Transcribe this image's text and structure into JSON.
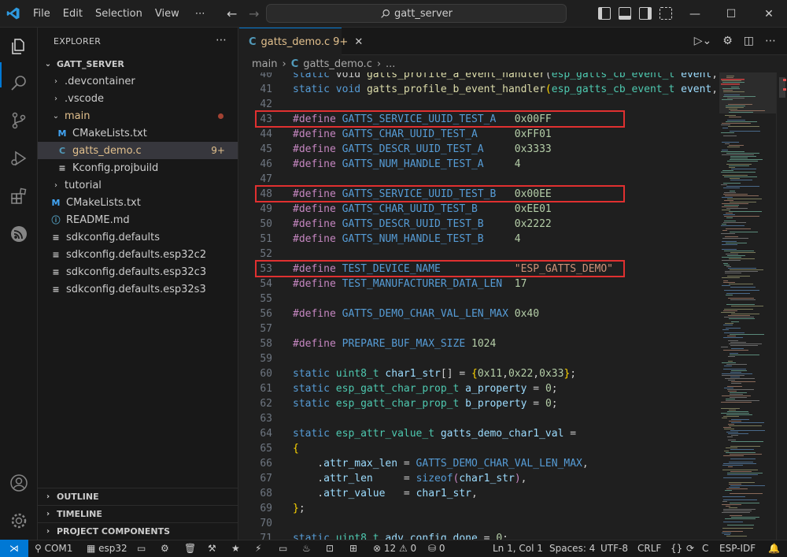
{
  "menu": [
    "File",
    "Edit",
    "Selection",
    "View"
  ],
  "search": {
    "label": "gatt_server"
  },
  "explorer": {
    "title": "EXPLORER",
    "root": "GATT_SERVER",
    "items": [
      {
        "label": ".devcontainer",
        "type": "folder",
        "depth": 1,
        "open": false
      },
      {
        "label": ".vscode",
        "type": "folder",
        "depth": 1,
        "open": false
      },
      {
        "label": "main",
        "type": "folder",
        "depth": 1,
        "open": true,
        "modified": true
      },
      {
        "label": "CMakeLists.txt",
        "type": "cmake",
        "depth": 2
      },
      {
        "label": "gatts_demo.c",
        "type": "c",
        "depth": 2,
        "selected": true,
        "badge": "9+"
      },
      {
        "label": "Kconfig.projbuild",
        "type": "lines",
        "depth": 2
      },
      {
        "label": "tutorial",
        "type": "folder",
        "depth": 1,
        "open": false
      },
      {
        "label": "CMakeLists.txt",
        "type": "cmake",
        "depth": 1
      },
      {
        "label": "README.md",
        "type": "info",
        "depth": 1
      },
      {
        "label": "sdkconfig.defaults",
        "type": "lines",
        "depth": 1
      },
      {
        "label": "sdkconfig.defaults.esp32c2",
        "type": "lines",
        "depth": 1
      },
      {
        "label": "sdkconfig.defaults.esp32c3",
        "type": "lines",
        "depth": 1
      },
      {
        "label": "sdkconfig.defaults.esp32s3",
        "type": "lines",
        "depth": 1
      }
    ],
    "panels": [
      "OUTLINE",
      "TIMELINE",
      "PROJECT COMPONENTS"
    ]
  },
  "tab": {
    "name": "gatts_demo.c",
    "badge": "9+",
    "icon": "C"
  },
  "breadcrumb": {
    "folder": "main",
    "file": "gatts_demo.c",
    "more": "..."
  },
  "code": [
    {
      "n": "40",
      "t": [
        [
          "kw",
          "static "
        ],
        [
          "plain",
          "void "
        ],
        [
          "fn",
          "gatts_profile_a_event_handler"
        ],
        [
          "plain",
          "("
        ],
        [
          "ty",
          "esp_gatts_cb_event_t"
        ],
        [
          "var",
          " event"
        ],
        [
          "plain",
          ","
        ]
      ]
    },
    {
      "n": "41",
      "t": [
        [
          "kw",
          "static "
        ],
        [
          "kw",
          "void "
        ],
        [
          "fn",
          "gatts_profile_b_event_handler"
        ],
        [
          "yel",
          "("
        ],
        [
          "ty",
          "esp_gatts_cb_event_t"
        ],
        [
          "var",
          " event"
        ],
        [
          "plain",
          ","
        ]
      ]
    },
    {
      "n": "42",
      "t": []
    },
    {
      "n": "43",
      "t": [
        [
          "pp",
          "#define "
        ],
        [
          "mc",
          "GATTS_SERVICE_UUID_TEST_A"
        ],
        [
          "plain",
          "   "
        ],
        [
          "num",
          "0x00FF"
        ]
      ]
    },
    {
      "n": "44",
      "t": [
        [
          "pp",
          "#define "
        ],
        [
          "mc",
          "GATTS_CHAR_UUID_TEST_A"
        ],
        [
          "plain",
          "      "
        ],
        [
          "num",
          "0xFF01"
        ]
      ]
    },
    {
      "n": "45",
      "t": [
        [
          "pp",
          "#define "
        ],
        [
          "mc",
          "GATTS_DESCR_UUID_TEST_A"
        ],
        [
          "plain",
          "     "
        ],
        [
          "num",
          "0x3333"
        ]
      ]
    },
    {
      "n": "46",
      "t": [
        [
          "pp",
          "#define "
        ],
        [
          "mc",
          "GATTS_NUM_HANDLE_TEST_A"
        ],
        [
          "plain",
          "     "
        ],
        [
          "num",
          "4"
        ]
      ]
    },
    {
      "n": "47",
      "t": []
    },
    {
      "n": "48",
      "t": [
        [
          "pp",
          "#define "
        ],
        [
          "mc",
          "GATTS_SERVICE_UUID_TEST_B"
        ],
        [
          "plain",
          "   "
        ],
        [
          "num",
          "0x00EE"
        ]
      ]
    },
    {
      "n": "49",
      "t": [
        [
          "pp",
          "#define "
        ],
        [
          "mc",
          "GATTS_CHAR_UUID_TEST_B"
        ],
        [
          "plain",
          "      "
        ],
        [
          "num",
          "0xEE01"
        ]
      ]
    },
    {
      "n": "50",
      "t": [
        [
          "pp",
          "#define "
        ],
        [
          "mc",
          "GATTS_DESCR_UUID_TEST_B"
        ],
        [
          "plain",
          "     "
        ],
        [
          "num",
          "0x2222"
        ]
      ]
    },
    {
      "n": "51",
      "t": [
        [
          "pp",
          "#define "
        ],
        [
          "mc",
          "GATTS_NUM_HANDLE_TEST_B"
        ],
        [
          "plain",
          "     "
        ],
        [
          "num",
          "4"
        ]
      ]
    },
    {
      "n": "52",
      "t": []
    },
    {
      "n": "53",
      "t": [
        [
          "pp",
          "#define "
        ],
        [
          "mc",
          "TEST_DEVICE_NAME"
        ],
        [
          "plain",
          "            "
        ],
        [
          "str",
          "\"ESP_GATTS_DEMO\""
        ]
      ]
    },
    {
      "n": "54",
      "t": [
        [
          "pp",
          "#define "
        ],
        [
          "mc",
          "TEST_MANUFACTURER_DATA_LEN"
        ],
        [
          "plain",
          "  "
        ],
        [
          "num",
          "17"
        ]
      ]
    },
    {
      "n": "55",
      "t": []
    },
    {
      "n": "56",
      "t": [
        [
          "pp",
          "#define "
        ],
        [
          "mc",
          "GATTS_DEMO_CHAR_VAL_LEN_MAX"
        ],
        [
          "plain",
          " "
        ],
        [
          "num",
          "0x40"
        ]
      ]
    },
    {
      "n": "57",
      "t": []
    },
    {
      "n": "58",
      "t": [
        [
          "pp",
          "#define "
        ],
        [
          "mc",
          "PREPARE_BUF_MAX_SIZE"
        ],
        [
          "plain",
          " "
        ],
        [
          "num",
          "1024"
        ]
      ]
    },
    {
      "n": "59",
      "t": []
    },
    {
      "n": "60",
      "t": [
        [
          "kw",
          "static "
        ],
        [
          "ty",
          "uint8_t "
        ],
        [
          "var",
          "char1_str"
        ],
        [
          "plain",
          "[] = "
        ],
        [
          "yel",
          "{"
        ],
        [
          "num",
          "0x11"
        ],
        [
          "plain",
          ","
        ],
        [
          "num",
          "0x22"
        ],
        [
          "plain",
          ","
        ],
        [
          "num",
          "0x33"
        ],
        [
          "yel",
          "}"
        ],
        [
          "plain",
          ";"
        ]
      ]
    },
    {
      "n": "61",
      "t": [
        [
          "kw",
          "static "
        ],
        [
          "ty",
          "esp_gatt_char_prop_t "
        ],
        [
          "var",
          "a_property"
        ],
        [
          "plain",
          " = "
        ],
        [
          "num",
          "0"
        ],
        [
          "plain",
          ";"
        ]
      ]
    },
    {
      "n": "62",
      "t": [
        [
          "kw",
          "static "
        ],
        [
          "ty",
          "esp_gatt_char_prop_t "
        ],
        [
          "var",
          "b_property"
        ],
        [
          "plain",
          " = "
        ],
        [
          "num",
          "0"
        ],
        [
          "plain",
          ";"
        ]
      ]
    },
    {
      "n": "63",
      "t": []
    },
    {
      "n": "64",
      "t": [
        [
          "kw",
          "static "
        ],
        [
          "ty",
          "esp_attr_value_t "
        ],
        [
          "var",
          "gatts_demo_char1_val"
        ],
        [
          "plain",
          " ="
        ]
      ]
    },
    {
      "n": "65",
      "t": [
        [
          "yel",
          "{"
        ]
      ]
    },
    {
      "n": "66",
      "t": [
        [
          "plain",
          "    ."
        ],
        [
          "var",
          "attr_max_len"
        ],
        [
          "plain",
          " = "
        ],
        [
          "mc",
          "GATTS_DEMO_CHAR_VAL_LEN_MAX"
        ],
        [
          "plain",
          ","
        ]
      ]
    },
    {
      "n": "67",
      "t": [
        [
          "plain",
          "    ."
        ],
        [
          "var",
          "attr_len"
        ],
        [
          "plain",
          "     = "
        ],
        [
          "kw",
          "sizeof"
        ],
        [
          "pp",
          "("
        ],
        [
          "var",
          "char1_str"
        ],
        [
          "pp",
          ")"
        ],
        [
          "plain",
          ","
        ]
      ]
    },
    {
      "n": "68",
      "t": [
        [
          "plain",
          "    ."
        ],
        [
          "var",
          "attr_value"
        ],
        [
          "plain",
          "   = "
        ],
        [
          "var",
          "char1_str"
        ],
        [
          "plain",
          ","
        ]
      ]
    },
    {
      "n": "69",
      "t": [
        [
          "yel",
          "}"
        ],
        [
          "plain",
          ";"
        ]
      ]
    },
    {
      "n": "70",
      "t": []
    },
    {
      "n": "71",
      "t": [
        [
          "kw",
          "static "
        ],
        [
          "ty",
          "uint8_t "
        ],
        [
          "var",
          "adv_config_done"
        ],
        [
          "plain",
          " = "
        ],
        [
          "num",
          "0"
        ],
        [
          "plain",
          ";"
        ]
      ]
    }
  ],
  "highlight_lines": [
    "43",
    "48",
    "53"
  ],
  "status": {
    "port": "COM1",
    "target": "esp32",
    "errors": "12",
    "warnings": "0",
    "ports": "0",
    "position": "Ln 1, Col 1",
    "spaces": "Spaces: 4",
    "encoding": "UTF-8",
    "eol": "CRLF",
    "lang_braces": "{}",
    "lang": "C",
    "framework": "ESP-IDF"
  },
  "colors": {
    "accent": "#0078d4",
    "highlight_box": "#e03030",
    "modified": "#e2c08d"
  }
}
